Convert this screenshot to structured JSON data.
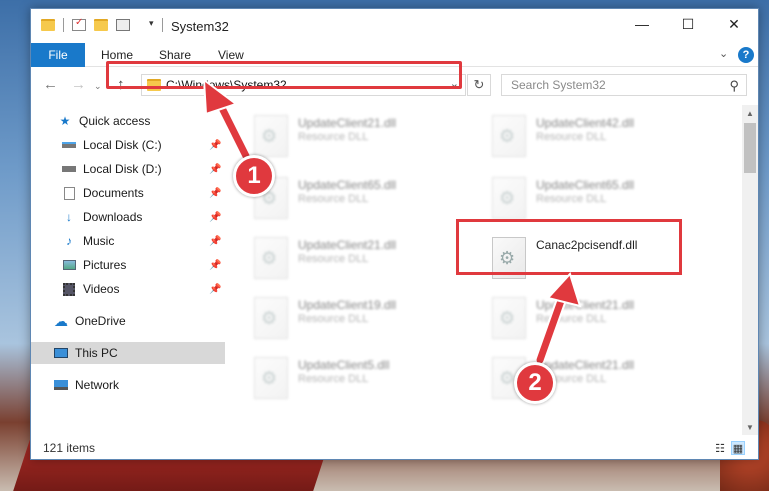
{
  "window": {
    "title": "System32",
    "controls": {
      "minimize": "—",
      "maximize": "☐",
      "close": "✕"
    }
  },
  "ribbon": {
    "tabs": [
      "File",
      "Home",
      "Share",
      "View"
    ],
    "help_label": "?"
  },
  "address_bar": {
    "path": "C:\\Windows\\System32",
    "refresh_glyph": "↻",
    "dropdown_glyph": "⌄"
  },
  "search": {
    "placeholder": "Search System32"
  },
  "sidebar": {
    "items": [
      {
        "label": "Quick access",
        "icon": "star-icon"
      },
      {
        "label": "Local Disk (C:)",
        "icon": "drive-icon",
        "pinned": true
      },
      {
        "label": "Local Disk (D:)",
        "icon": "drive-icon",
        "pinned": true
      },
      {
        "label": "Documents",
        "icon": "documents-icon",
        "pinned": true
      },
      {
        "label": "Downloads",
        "icon": "download-icon",
        "pinned": true
      },
      {
        "label": "Music",
        "icon": "music-icon",
        "pinned": true
      },
      {
        "label": "Pictures",
        "icon": "pictures-icon",
        "pinned": true
      },
      {
        "label": "Videos",
        "icon": "videos-icon",
        "pinned": true
      },
      {
        "label": "OneDrive",
        "icon": "cloud-icon"
      },
      {
        "label": "This PC",
        "icon": "computer-icon",
        "selected": true
      },
      {
        "label": "Network",
        "icon": "network-icon"
      }
    ]
  },
  "files": [
    {
      "name": "UpdateClient21.dll",
      "type": "Resource DLL"
    },
    {
      "name": "UpdateClient42.dll",
      "type": "Resource DLL"
    },
    {
      "name": "UpdateClient65.dll",
      "type": "Resource DLL"
    },
    {
      "name": "UpdateClient65.dll",
      "type": "Resource DLL"
    },
    {
      "name": "UpdateClient21.dll",
      "type": "Resource DLL"
    },
    {
      "name": "Canac2pcisendf.dll",
      "type": ""
    },
    {
      "name": "UpdateClient19.dll",
      "type": "Resource DLL"
    },
    {
      "name": "UpdateClient21.dll",
      "type": "Resource DLL"
    },
    {
      "name": "UpdateClient5.dll",
      "type": "Resource DLL"
    },
    {
      "name": "UpdateClient21.dll",
      "type": "Resource DLL"
    }
  ],
  "status": {
    "item_count": "121 items"
  },
  "annotations": {
    "step1": "1",
    "step2": "2"
  },
  "colors": {
    "accent": "#1979ca",
    "highlight": "#e0393e"
  }
}
